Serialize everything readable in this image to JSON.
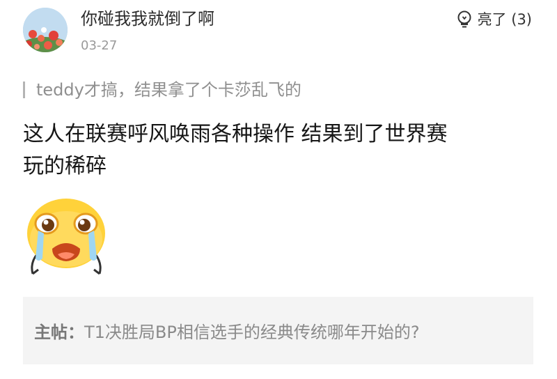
{
  "comment": {
    "username": "你碰我我就倒了啊",
    "date": "03-27",
    "like_label": "亮了 (3)",
    "quote_text": "teddy才搞，结果拿了个卡莎乱飞的",
    "content_line1": "这人在联赛呼风唤雨各种操作  结果到了世界赛",
    "content_line2": "玩的稀碎",
    "avatar_icon": "avatar-flowers-sky",
    "like_icon": "lightbulb-icon",
    "sticker_icon": "crying-face-sticker"
  },
  "main_post": {
    "label": "主帖：",
    "title": "T1决胜局BP相信选手的经典传统哪年开始的?"
  },
  "colors": {
    "sticker_face": "#ffd23a",
    "sticker_tears": "#9fd6f2",
    "mainpost_bg": "#f4f4f4"
  }
}
